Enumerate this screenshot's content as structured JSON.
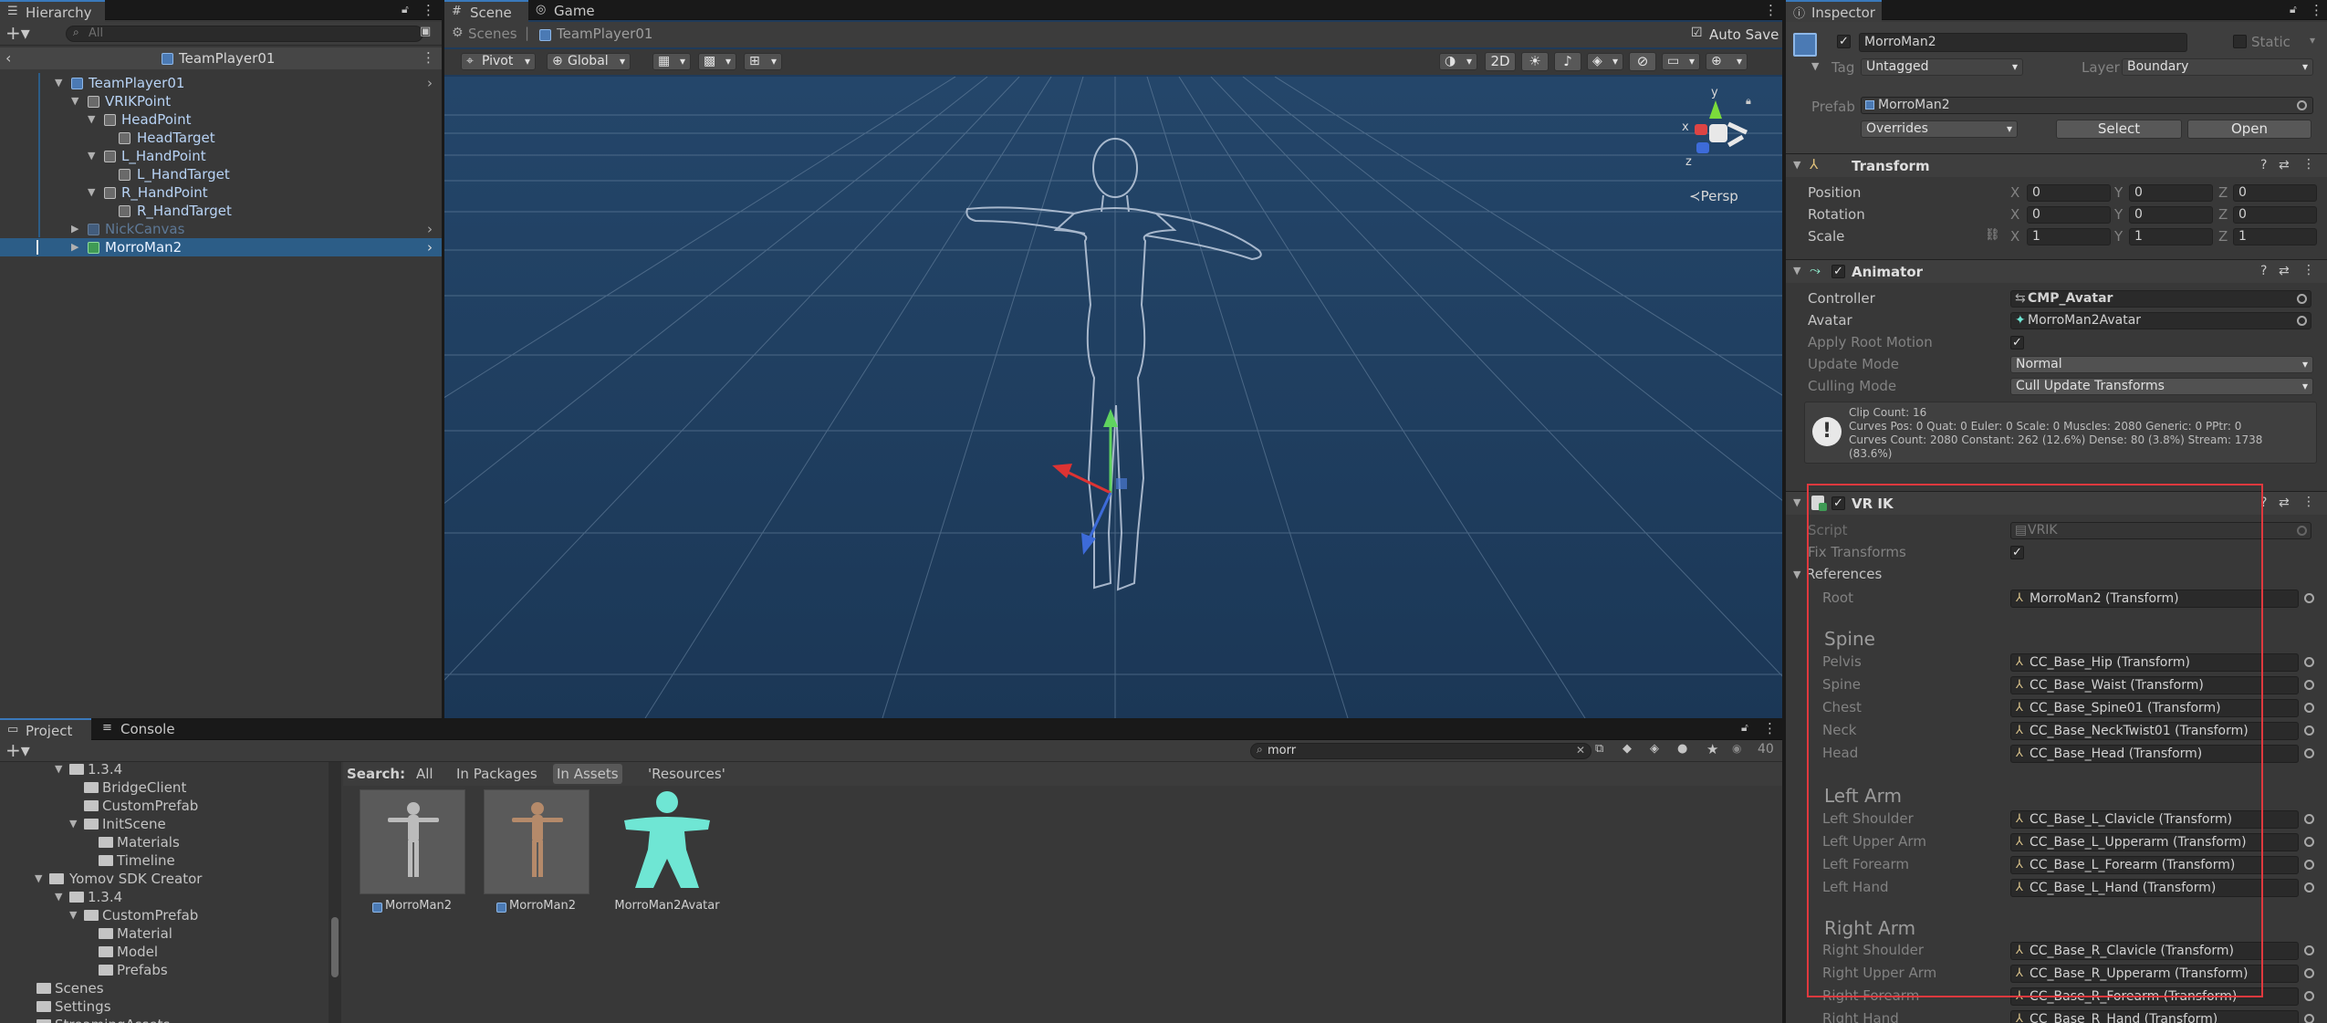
{
  "hierarchy": {
    "tab": "Hierarchy",
    "search_placeholder": "All",
    "scene_root": "TeamPlayer01",
    "items": [
      {
        "label": "TeamPlayer01"
      },
      {
        "label": "VRIKPoint"
      },
      {
        "label": "HeadPoint"
      },
      {
        "label": "HeadTarget"
      },
      {
        "label": "L_HandPoint"
      },
      {
        "label": "L_HandTarget"
      },
      {
        "label": "R_HandPoint"
      },
      {
        "label": "R_HandTarget"
      },
      {
        "label": "NickCanvas"
      },
      {
        "label": "MorroMan2"
      }
    ]
  },
  "scene": {
    "tabs": [
      "Scene",
      "Game"
    ],
    "breadcrumb": [
      "Scenes",
      "TeamPlayer01"
    ],
    "auto_save": "Auto Save",
    "pivot": "Pivot",
    "global": "Global",
    "mode_2d": "2D",
    "persp": "Persp",
    "gizmo_axes": [
      "y",
      "x",
      "z"
    ]
  },
  "project": {
    "tabs": [
      "Project",
      "Console"
    ],
    "search_value": "morr",
    "count": "40",
    "search_label": "Search:",
    "filters": [
      "All",
      "In Packages",
      "In Assets",
      "'Resources'"
    ],
    "tree": [
      {
        "label": "1.3.4"
      },
      {
        "label": "BridgeClient"
      },
      {
        "label": "CustomPrefab"
      },
      {
        "label": "InitScene"
      },
      {
        "label": "Materials"
      },
      {
        "label": "Timeline"
      },
      {
        "label": "Yomov SDK Creator"
      },
      {
        "label": "1.3.4"
      },
      {
        "label": "CustomPrefab"
      },
      {
        "label": "Material"
      },
      {
        "label": "Model"
      },
      {
        "label": "Prefabs"
      },
      {
        "label": "Scenes"
      },
      {
        "label": "Settings"
      },
      {
        "label": "StreamingAssets"
      }
    ],
    "assets": [
      {
        "label": "MorroMan2"
      },
      {
        "label": "MorroMan2"
      },
      {
        "label": "MorroMan2Avatar"
      }
    ]
  },
  "inspector": {
    "tab": "Inspector",
    "object_name": "MorroMan2",
    "static_label": "Static",
    "tag_label": "Tag",
    "tag_value": "Untagged",
    "layer_label": "Layer",
    "layer_value": "Boundary",
    "prefab_label": "Prefab",
    "prefab_value": "MorroMan2",
    "overrides": "Overrides",
    "select": "Select",
    "open": "Open",
    "transform": {
      "title": "Transform",
      "rows": [
        {
          "label": "Position",
          "x": "0",
          "y": "0",
          "z": "0"
        },
        {
          "label": "Rotation",
          "x": "0",
          "y": "0",
          "z": "0"
        },
        {
          "label": "Scale",
          "x": "1",
          "y": "1",
          "z": "1"
        }
      ]
    },
    "animator": {
      "title": "Animator",
      "controller_label": "Controller",
      "controller_value": "CMP_Avatar",
      "avatar_label": "Avatar",
      "avatar_value": "MorroMan2Avatar",
      "apply_root_label": "Apply Root Motion",
      "update_label": "Update Mode",
      "update_value": "Normal",
      "culling_label": "Culling Mode",
      "culling_value": "Cull Update Transforms",
      "info_1": "Clip Count: 16",
      "info_2": "Curves Pos: 0 Quat: 0 Euler: 0 Scale: 0 Muscles: 2080 Generic: 0 PPtr: 0",
      "info_3": "Curves Count: 2080 Constant: 262 (12.6%) Dense: 80 (3.8%) Stream: 1738",
      "info_4": "(83.6%)"
    },
    "vrik": {
      "title": "VR IK",
      "script_label": "Script",
      "script_value": "VRIK",
      "fix_label": "Fix Transforms",
      "references_label": "References",
      "root_label": "Root",
      "root_value": "MorroMan2 (Transform)",
      "spine_section": "Spine",
      "spine_rows": [
        {
          "label": "Pelvis",
          "value": "CC_Base_Hip (Transform)"
        },
        {
          "label": "Spine",
          "value": "CC_Base_Waist (Transform)"
        },
        {
          "label": "Chest",
          "value": "CC_Base_Spine01 (Transform)"
        },
        {
          "label": "Neck",
          "value": "CC_Base_NeckTwist01 (Transform)"
        },
        {
          "label": "Head",
          "value": "CC_Base_Head (Transform)"
        }
      ],
      "left_section": "Left Arm",
      "left_rows": [
        {
          "label": "Left Shoulder",
          "value": "CC_Base_L_Clavicle (Transform)"
        },
        {
          "label": "Left Upper Arm",
          "value": "CC_Base_L_Upperarm (Transform)"
        },
        {
          "label": "Left Forearm",
          "value": "CC_Base_L_Forearm (Transform)"
        },
        {
          "label": "Left Hand",
          "value": "CC_Base_L_Hand (Transform)"
        }
      ],
      "right_section": "Right Arm",
      "right_rows": [
        {
          "label": "Right Shoulder",
          "value": "CC_Base_R_Clavicle (Transform)"
        },
        {
          "label": "Right Upper Arm",
          "value": "CC_Base_R_Upperarm (Transform)"
        },
        {
          "label": "Right Forearm",
          "value": "CC_Base_R_Forearm (Transform)"
        },
        {
          "label": "Right Hand",
          "value": "CC_Base_R_Hand (Transform)"
        }
      ]
    }
  },
  "colors": {
    "selection": "#2c5d87",
    "highlight_box": "#e0393e",
    "scene_bg": "#1d3c5e",
    "accent": "#3a79bb"
  }
}
